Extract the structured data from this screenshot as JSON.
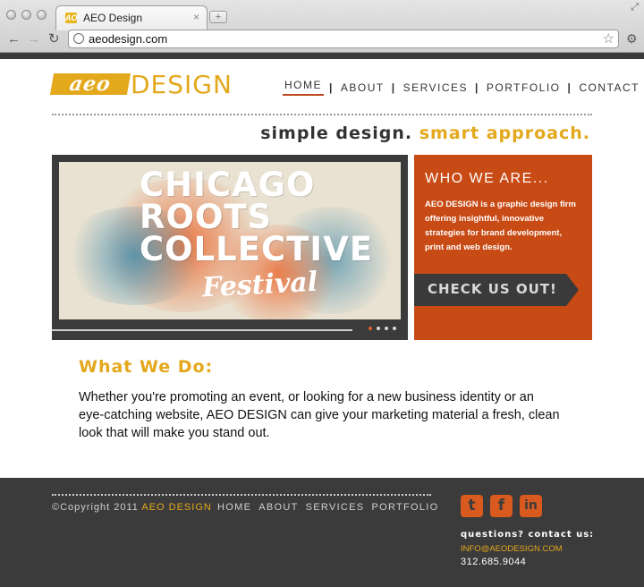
{
  "browser": {
    "tab_title": "AEO Design",
    "tab_logo": "AO",
    "tab_close": "×",
    "new_tab": "+",
    "url": "aeodesign.com",
    "back_icon": "←",
    "forward_icon": "→",
    "reload_icon": "↻",
    "bookmark_icon": "☆",
    "wrench_icon": "🔧"
  },
  "site": {
    "logo_mark": "aeo",
    "logo_word": "DESIGN",
    "nav": [
      "HOME",
      "ABOUT",
      "SERVICES",
      "PORTFOLIO",
      "CONTACT"
    ],
    "nav_separator": "|",
    "tagline_a": "simple design.",
    "tagline_b": "smart approach.",
    "slide": {
      "line1": "CHICAGO",
      "line2": "ROOTS",
      "line3": "COLLECTIVE",
      "script": "Festival",
      "dots": 4,
      "active_dot": 0
    },
    "who": {
      "title": "WHO WE ARE...",
      "text": "AEO DESIGN is a graphic design firm offering insightful, innovative strategies for brand development, print and web design.",
      "cta": "CHECK US OUT!"
    },
    "what_we_do": {
      "title": "What We Do:",
      "text": "Whether you're promoting an event, or looking for a new business identity or an eye-catching website, AEO DESIGN can give your marketing material a fresh, clean look that will make you stand out."
    },
    "footer": {
      "copyright_prefix": "©Copyright 2011",
      "copyright_brand": "AEO DESIGN",
      "nav": [
        "HOME",
        "ABOUT",
        "SERVICES",
        "PORTFOLIO"
      ],
      "social": [
        "t",
        "f",
        "in"
      ],
      "question": "questions? contact us:",
      "email": "INFO@AEODESIGN.COM",
      "phone": "312.685.9044"
    }
  },
  "colors": {
    "accent_yellow": "#e3a81c",
    "accent_orange": "#c84a14",
    "dark": "#3b3b3b"
  }
}
